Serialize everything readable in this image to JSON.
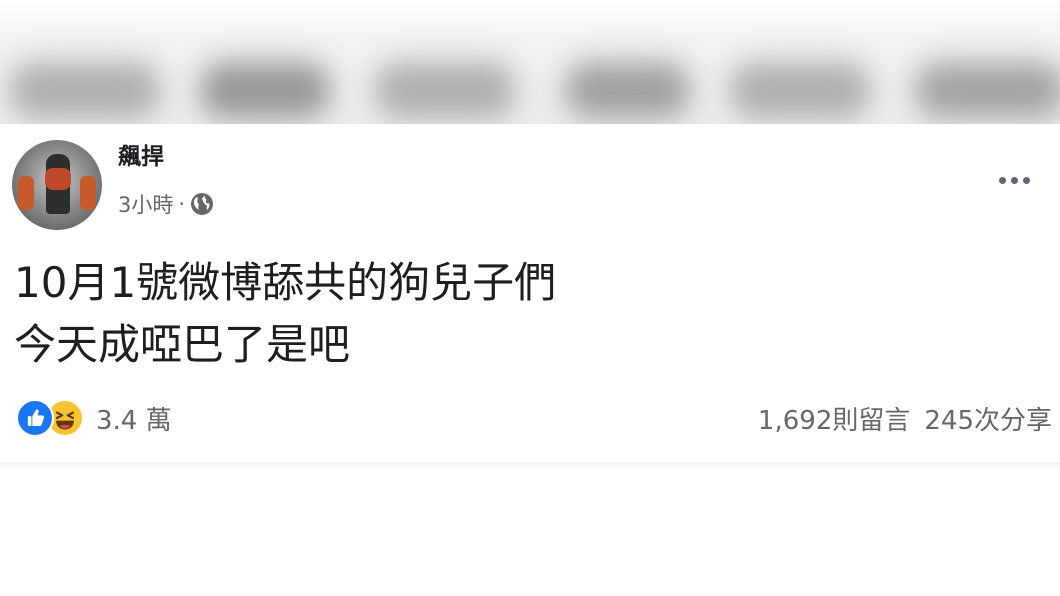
{
  "post": {
    "author": "飆捍",
    "time": "3小時",
    "separator": "·",
    "privacy_icon": "globe-icon",
    "more_icon": "more-options-icon",
    "content_lines": [
      "10月1號微博舔共的狗兒子們",
      "今天成啞巴了是吧"
    ],
    "reactions": {
      "icons": [
        "like-icon",
        "haha-icon"
      ],
      "count": "3.4 萬"
    },
    "comments": "1,692則留言",
    "shares": "245次分享"
  },
  "colors": {
    "text_primary": "#1c1e21",
    "text_secondary": "#65676b",
    "like_blue": "#1877f2",
    "haha_yellow": "#f7c531"
  }
}
